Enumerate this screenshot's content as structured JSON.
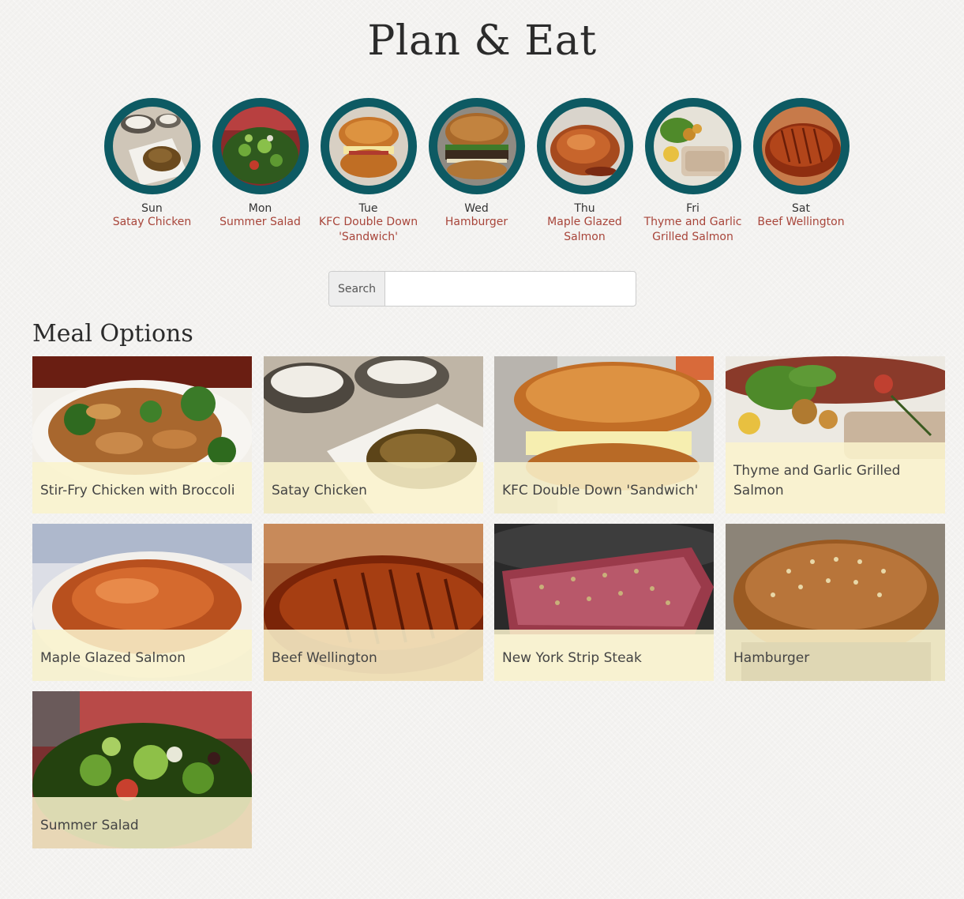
{
  "app": {
    "title": "Plan & Eat"
  },
  "week": [
    {
      "day": "Sun",
      "meal": "Satay Chicken",
      "icon": "satay-chicken-photo"
    },
    {
      "day": "Mon",
      "meal": "Summer Salad",
      "icon": "summer-salad-photo"
    },
    {
      "day": "Tue",
      "meal": "KFC Double Down 'Sandwich'",
      "icon": "kfc-double-down-photo"
    },
    {
      "day": "Wed",
      "meal": "Hamburger",
      "icon": "hamburger-photo"
    },
    {
      "day": "Thu",
      "meal": "Maple Glazed Salmon",
      "icon": "maple-glazed-salmon-photo"
    },
    {
      "day": "Fri",
      "meal": "Thyme and Garlic Grilled Salmon",
      "icon": "thyme-garlic-salmon-photo"
    },
    {
      "day": "Sat",
      "meal": "Beef Wellington",
      "icon": "beef-wellington-photo"
    }
  ],
  "search": {
    "label": "Search",
    "value": "",
    "placeholder": ""
  },
  "meal_options": {
    "title": "Meal Options",
    "items": [
      {
        "name": "Stir-Fry Chicken with Broccoli",
        "icon": "stir-fry-photo"
      },
      {
        "name": "Satay Chicken",
        "icon": "satay-chicken-photo"
      },
      {
        "name": "KFC Double Down 'Sandwich'",
        "icon": "kfc-double-down-photo"
      },
      {
        "name": "Thyme and Garlic Grilled Salmon",
        "icon": "thyme-garlic-salmon-photo"
      },
      {
        "name": "Maple Glazed Salmon",
        "icon": "maple-glazed-salmon-photo"
      },
      {
        "name": "Beef Wellington",
        "icon": "beef-wellington-photo"
      },
      {
        "name": "New York Strip Steak",
        "icon": "strip-steak-photo"
      },
      {
        "name": "Hamburger",
        "icon": "hamburger-photo"
      },
      {
        "name": "Summer Salad",
        "icon": "summer-salad-photo"
      }
    ]
  },
  "colors": {
    "ring": "#0d5a63",
    "meal_link": "#a8453a",
    "card_label_bg": "#faf3cd"
  }
}
